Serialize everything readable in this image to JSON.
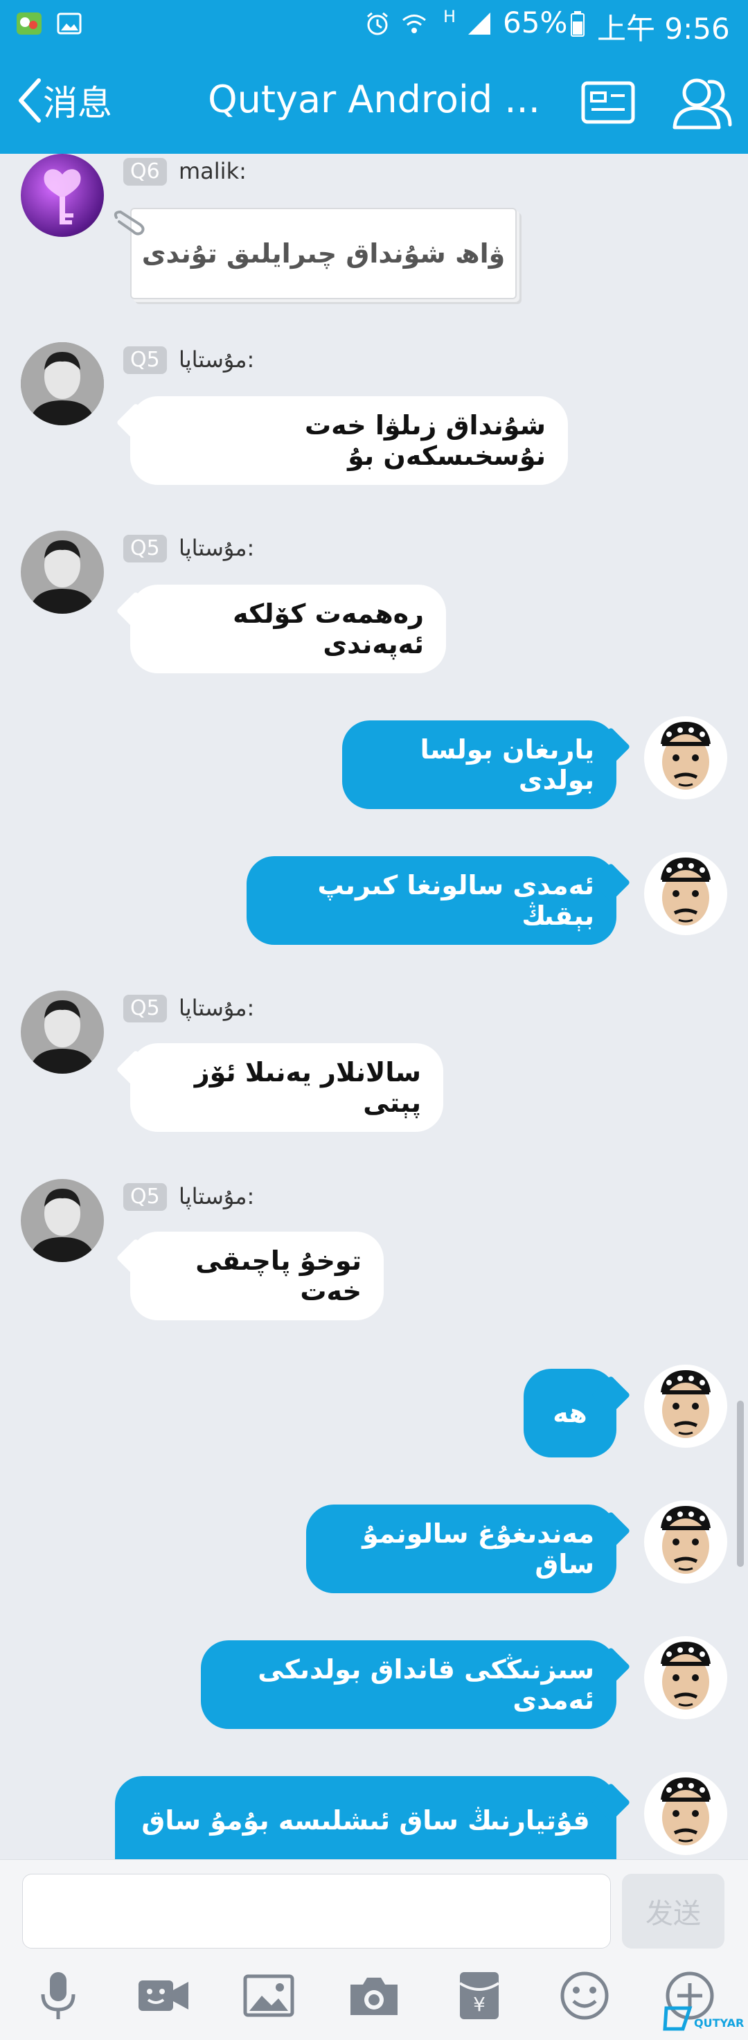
{
  "status_bar": {
    "battery": "65%",
    "time": "上午 9:56",
    "network": "H"
  },
  "nav": {
    "back_label": "消息",
    "title": "Qutyar Android ..."
  },
  "messages": [
    {
      "direction": "in",
      "badge": "Q6",
      "sender": "malik:",
      "text": "ۋاھ شۇنداق چىرايلىق تۇندى"
    },
    {
      "direction": "in",
      "badge": "Q5",
      "sender": "مۇستاپا:",
      "text": "شۇنداق زىلۋا خەت نۇسخىسكەن بۇ"
    },
    {
      "direction": "in",
      "badge": "Q5",
      "sender": "مۇستاپا:",
      "text": "رەھمەت كۆلكە ئەپەندى"
    },
    {
      "direction": "out",
      "text": "يارىغان بولسا بولدى"
    },
    {
      "direction": "out",
      "text": "ئەمدى سالونغا كىرىپ بېقىڭ"
    },
    {
      "direction": "in",
      "badge": "Q5",
      "sender": "مۇستاپا:",
      "text": "سالانلار يەنىلا ئۆز پېتى"
    },
    {
      "direction": "in",
      "badge": "Q5",
      "sender": "مۇستاپا:",
      "text": "توخۇ پاچىقى خەت"
    },
    {
      "direction": "out",
      "text": "ھە"
    },
    {
      "direction": "out",
      "text": "مەندىغۇغ سالونمۇ ساق"
    },
    {
      "direction": "out",
      "text": "سىزنىڭكى قانداق بولدىكى ئەمدى"
    },
    {
      "direction": "out",
      "text": "قۇتيارنىڭ ساق ئىشلىسە بۇمۇ ساق"
    }
  ],
  "input": {
    "placeholder": "",
    "send_label": "发送"
  },
  "toolbar": [
    "microphone-icon",
    "video-call-icon",
    "image-icon",
    "camera-icon",
    "red-packet-icon",
    "emoji-icon",
    "plus-icon"
  ],
  "watermark": {
    "text": "QUTYAR"
  },
  "colors": {
    "accent": "#12a3e0",
    "background": "#e9ecf1",
    "incoming_bubble": "#ffffff"
  }
}
